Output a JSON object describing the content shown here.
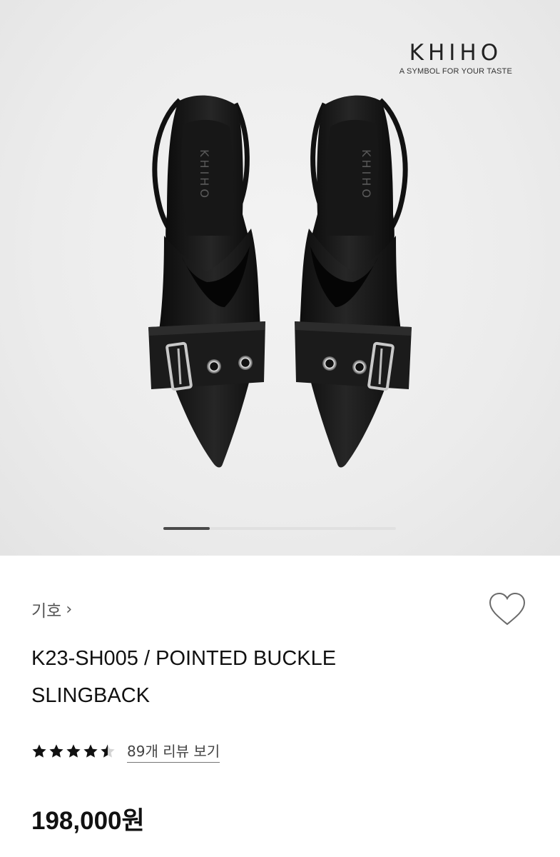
{
  "hero": {
    "logo_word": "KHIHO",
    "logo_tagline": "A SYMBOL FOR YOUR TASTE",
    "shoe_insole_print": "KHIHO",
    "carousel": {
      "total_slides": 5,
      "active_slide": 1
    }
  },
  "product": {
    "brand": "기호",
    "brand_chevron": "›",
    "title": "K23-SH005 / POINTED BUCKLE SLINGBACK",
    "rating_stars": 4.5,
    "review_link": "89개 리뷰 보기",
    "price": "198,000원"
  },
  "icons": {
    "brand_chevron": "chevron-right-icon",
    "wishlist": "heart-outline-icon",
    "star": "star-icon"
  },
  "colors": {
    "hero_background": "#ececec",
    "shoe": "#141414",
    "text_primary": "#111111",
    "text_secondary": "#555555",
    "carousel_active": "#4a4a4a",
    "carousel_track": "#e0e0e0"
  }
}
